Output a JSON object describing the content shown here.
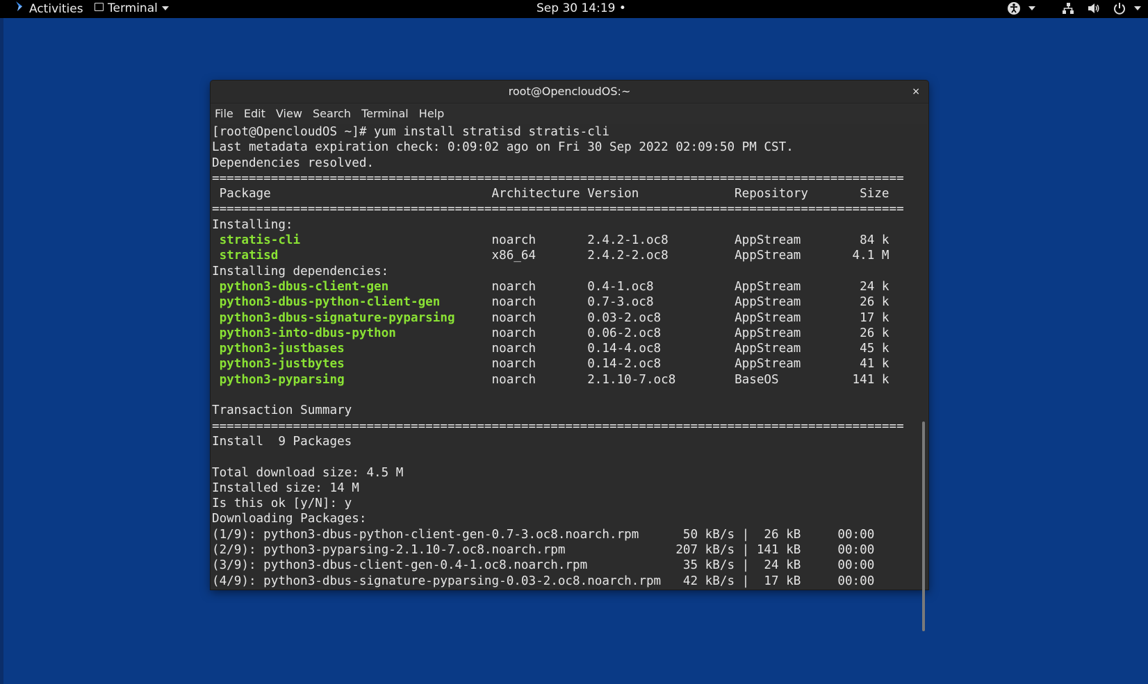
{
  "topbar": {
    "activities": "Activities",
    "app_name": "Terminal",
    "clock": "Sep 30  14:19",
    "clock_dot": "•"
  },
  "window": {
    "title": "root@OpencloudOS:~",
    "close": "×",
    "menu": [
      "File",
      "Edit",
      "View",
      "Search",
      "Terminal",
      "Help"
    ]
  },
  "terminal": {
    "lines": [
      {
        "t": "[root@OpencloudOS ~]# yum install stratisd stratis-cli"
      },
      {
        "t": "Last metadata expiration check: 0:09:02 ago on Fri 30 Sep 2022 02:09:50 PM CST."
      },
      {
        "t": "Dependencies resolved."
      },
      {
        "t": "=============================================================================================="
      },
      {
        "t": " Package                              Architecture Version             Repository       Size"
      },
      {
        "t": "=============================================================================================="
      },
      {
        "t": "Installing:"
      },
      {
        "pkg": " stratis-cli",
        "rest": "                          noarch       2.4.2-1.oc8         AppStream        84 k"
      },
      {
        "pkg": " stratisd",
        "rest": "                             x86_64       2.4.2-2.oc8         AppStream       4.1 M"
      },
      {
        "t": "Installing dependencies:"
      },
      {
        "pkg": " python3-dbus-client-gen",
        "rest": "              noarch       0.4-1.oc8           AppStream        24 k"
      },
      {
        "pkg": " python3-dbus-python-client-gen",
        "rest": "       noarch       0.7-3.oc8           AppStream        26 k"
      },
      {
        "pkg": " python3-dbus-signature-pyparsing",
        "rest": "     noarch       0.03-2.oc8          AppStream        17 k"
      },
      {
        "pkg": " python3-into-dbus-python",
        "rest": "             noarch       0.06-2.oc8          AppStream        26 k"
      },
      {
        "pkg": " python3-justbases",
        "rest": "                    noarch       0.14-4.oc8          AppStream        45 k"
      },
      {
        "pkg": " python3-justbytes",
        "rest": "                    noarch       0.14-2.oc8          AppStream        41 k"
      },
      {
        "pkg": " python3-pyparsing",
        "rest": "                    noarch       2.1.10-7.oc8        BaseOS          141 k"
      },
      {
        "t": ""
      },
      {
        "t": "Transaction Summary"
      },
      {
        "t": "=============================================================================================="
      },
      {
        "t": "Install  9 Packages"
      },
      {
        "t": ""
      },
      {
        "t": "Total download size: 4.5 M"
      },
      {
        "t": "Installed size: 14 M"
      },
      {
        "t": "Is this ok [y/N]: y"
      },
      {
        "t": "Downloading Packages:"
      },
      {
        "t": "(1/9): python3-dbus-python-client-gen-0.7-3.oc8.noarch.rpm      50 kB/s |  26 kB     00:00"
      },
      {
        "t": "(2/9): python3-pyparsing-2.1.10-7.oc8.noarch.rpm               207 kB/s | 141 kB     00:00"
      },
      {
        "t": "(3/9): python3-dbus-client-gen-0.4-1.oc8.noarch.rpm             35 kB/s |  24 kB     00:00"
      },
      {
        "t": "(4/9): python3-dbus-signature-pyparsing-0.03-2.oc8.noarch.rpm   42 kB/s |  17 kB     00:00"
      }
    ]
  },
  "colors": {
    "desktop": "#0a3a86",
    "package_highlight": "#8ae234"
  }
}
